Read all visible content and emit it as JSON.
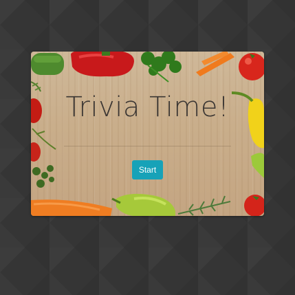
{
  "quiz": {
    "title": "Trivia Time!",
    "start_label": "Start"
  },
  "colors": {
    "page_background": "#353535",
    "button": "#17a2b8",
    "title_text": "#3b3633"
  }
}
